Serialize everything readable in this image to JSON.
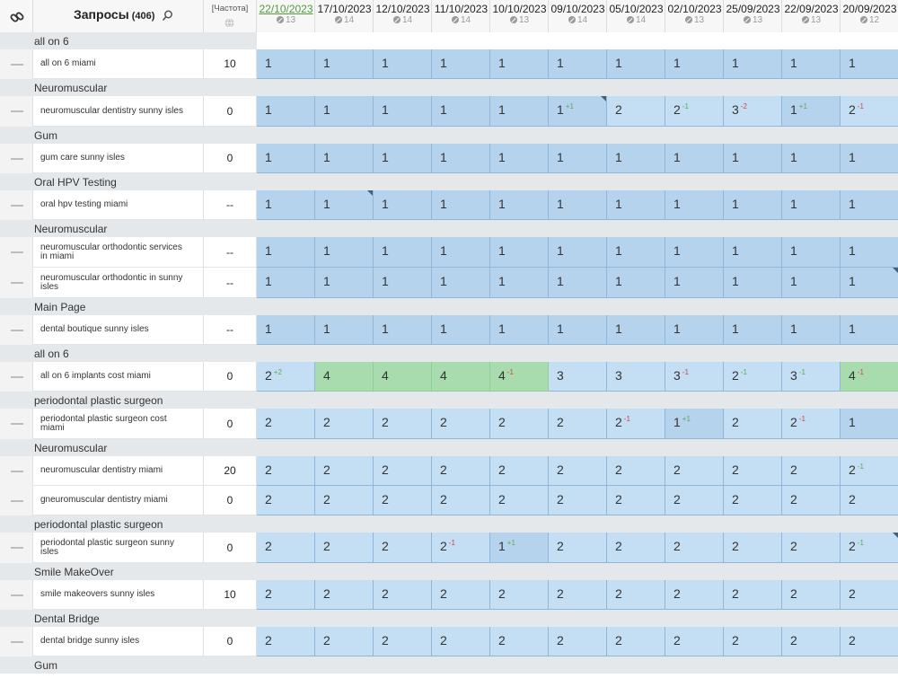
{
  "header": {
    "title": "Запросы",
    "count": "(406)",
    "frequency_label": "[Частота]",
    "dates": [
      {
        "date": "22/10/2023",
        "sub": "13",
        "active": true
      },
      {
        "date": "17/10/2023",
        "sub": "14"
      },
      {
        "date": "12/10/2023",
        "sub": "14"
      },
      {
        "date": "11/10/2023",
        "sub": "14"
      },
      {
        "date": "10/10/2023",
        "sub": "13"
      },
      {
        "date": "09/10/2023",
        "sub": "14"
      },
      {
        "date": "05/10/2023",
        "sub": "14"
      },
      {
        "date": "02/10/2023",
        "sub": "13"
      },
      {
        "date": "25/09/2023",
        "sub": "13"
      },
      {
        "date": "22/09/2023",
        "sub": "13"
      },
      {
        "date": "20/09/2023",
        "sub": "12"
      }
    ]
  },
  "colors": {
    "position_cell": "#b5d3ed",
    "position_cell_light": "#c4dff4",
    "position_cell_top": "#a8dcae",
    "group_row": "#e5e8eb",
    "delta_up": "#5aab4f",
    "delta_down": "#d94040",
    "active_date": "#4f9d3b"
  },
  "groups": [
    {
      "label": "all on 6",
      "rows": [
        {
          "keyword": "all on 6 miami",
          "freq": "10",
          "cells": [
            {
              "v": "1"
            },
            {
              "v": "1"
            },
            {
              "v": "1"
            },
            {
              "v": "1"
            },
            {
              "v": "1"
            },
            {
              "v": "1"
            },
            {
              "v": "1"
            },
            {
              "v": "1"
            },
            {
              "v": "1"
            },
            {
              "v": "1"
            },
            {
              "v": "1"
            }
          ]
        }
      ]
    },
    {
      "label": "Neuromuscular",
      "rows": [
        {
          "keyword": "neuromuscular dentistry sunny isles",
          "freq": "0",
          "cells": [
            {
              "v": "1"
            },
            {
              "v": "1"
            },
            {
              "v": "1"
            },
            {
              "v": "1"
            },
            {
              "v": "1"
            },
            {
              "v": "1",
              "d": "+1",
              "dir": "up",
              "flag": true
            },
            {
              "v": "2",
              "c": "l"
            },
            {
              "v": "2",
              "d": "-1",
              "dir": "up",
              "c": "l"
            },
            {
              "v": "3",
              "d": "-2",
              "dir": "down",
              "c": "l"
            },
            {
              "v": "1",
              "d": "+1",
              "dir": "up"
            },
            {
              "v": "2",
              "d": "-1",
              "dir": "down",
              "c": "l"
            }
          ]
        }
      ]
    },
    {
      "label": "Gum",
      "rows": [
        {
          "keyword": "gum care sunny isles",
          "freq": "0",
          "cells": [
            {
              "v": "1"
            },
            {
              "v": "1"
            },
            {
              "v": "1"
            },
            {
              "v": "1"
            },
            {
              "v": "1"
            },
            {
              "v": "1"
            },
            {
              "v": "1"
            },
            {
              "v": "1"
            },
            {
              "v": "1"
            },
            {
              "v": "1"
            },
            {
              "v": "1"
            }
          ]
        }
      ]
    },
    {
      "label": "Oral HPV Testing",
      "rows": [
        {
          "keyword": "oral hpv testing miami",
          "freq": "--",
          "cells": [
            {
              "v": "1"
            },
            {
              "v": "1",
              "flag": true
            },
            {
              "v": "1"
            },
            {
              "v": "1"
            },
            {
              "v": "1"
            },
            {
              "v": "1"
            },
            {
              "v": "1"
            },
            {
              "v": "1"
            },
            {
              "v": "1"
            },
            {
              "v": "1"
            },
            {
              "v": "1"
            }
          ]
        }
      ]
    },
    {
      "label": "Neuromuscular",
      "rows": [
        {
          "keyword": "neuromuscular orthodontic services in miami",
          "freq": "--",
          "cells": [
            {
              "v": "1"
            },
            {
              "v": "1"
            },
            {
              "v": "1"
            },
            {
              "v": "1"
            },
            {
              "v": "1"
            },
            {
              "v": "1"
            },
            {
              "v": "1"
            },
            {
              "v": "1"
            },
            {
              "v": "1"
            },
            {
              "v": "1"
            },
            {
              "v": "1"
            }
          ]
        },
        {
          "keyword": "neuromuscular orthodontic in sunny isles",
          "freq": "--",
          "cells": [
            {
              "v": "1"
            },
            {
              "v": "1"
            },
            {
              "v": "1"
            },
            {
              "v": "1"
            },
            {
              "v": "1"
            },
            {
              "v": "1"
            },
            {
              "v": "1"
            },
            {
              "v": "1"
            },
            {
              "v": "1"
            },
            {
              "v": "1"
            },
            {
              "v": "1",
              "flag": true
            }
          ]
        }
      ]
    },
    {
      "label": "Main Page",
      "rows": [
        {
          "keyword": "dental boutique sunny isles",
          "freq": "--",
          "cells": [
            {
              "v": "1"
            },
            {
              "v": "1"
            },
            {
              "v": "1"
            },
            {
              "v": "1"
            },
            {
              "v": "1"
            },
            {
              "v": "1"
            },
            {
              "v": "1"
            },
            {
              "v": "1"
            },
            {
              "v": "1"
            },
            {
              "v": "1"
            },
            {
              "v": "1"
            }
          ]
        }
      ]
    },
    {
      "label": "all on 6",
      "rows": [
        {
          "keyword": "all on 6 implants cost miami",
          "freq": "0",
          "cells": [
            {
              "v": "2",
              "d": "+2",
              "dir": "up",
              "c": "l"
            },
            {
              "v": "4",
              "c": "g"
            },
            {
              "v": "4",
              "c": "g"
            },
            {
              "v": "4",
              "c": "g"
            },
            {
              "v": "4",
              "d": "-1",
              "dir": "down",
              "c": "g"
            },
            {
              "v": "3",
              "c": "l"
            },
            {
              "v": "3",
              "c": "l"
            },
            {
              "v": "3",
              "d": "-1",
              "dir": "down",
              "c": "l"
            },
            {
              "v": "2",
              "d": "-1",
              "dir": "up",
              "c": "l"
            },
            {
              "v": "3",
              "d": "-1",
              "dir": "up",
              "c": "l"
            },
            {
              "v": "4",
              "d": "-1",
              "dir": "down",
              "c": "g"
            }
          ]
        }
      ]
    },
    {
      "label": "periodontal plastic surgeon",
      "rows": [
        {
          "keyword": "periodontal plastic surgeon cost miami",
          "freq": "0",
          "cells": [
            {
              "v": "2",
              "c": "l"
            },
            {
              "v": "2",
              "c": "l"
            },
            {
              "v": "2",
              "c": "l"
            },
            {
              "v": "2",
              "c": "l"
            },
            {
              "v": "2",
              "c": "l"
            },
            {
              "v": "2",
              "c": "l"
            },
            {
              "v": "2",
              "d": "-1",
              "dir": "down",
              "c": "l"
            },
            {
              "v": "1",
              "d": "+1",
              "dir": "up"
            },
            {
              "v": "2",
              "c": "l"
            },
            {
              "v": "2",
              "d": "-1",
              "dir": "down",
              "c": "l"
            },
            {
              "v": "1"
            }
          ]
        }
      ]
    },
    {
      "label": "Neuromuscular",
      "rows": [
        {
          "keyword": "neuromuscular dentistry miami",
          "freq": "20",
          "cells": [
            {
              "v": "2",
              "c": "l"
            },
            {
              "v": "2",
              "c": "l"
            },
            {
              "v": "2",
              "c": "l"
            },
            {
              "v": "2",
              "c": "l"
            },
            {
              "v": "2",
              "c": "l"
            },
            {
              "v": "2",
              "c": "l"
            },
            {
              "v": "2",
              "c": "l"
            },
            {
              "v": "2",
              "c": "l"
            },
            {
              "v": "2",
              "c": "l"
            },
            {
              "v": "2",
              "c": "l"
            },
            {
              "v": "2",
              "d": "-1",
              "dir": "up",
              "c": "l"
            }
          ]
        },
        {
          "keyword": "gneuromuscular dentistry miami",
          "freq": "0",
          "cells": [
            {
              "v": "2",
              "c": "l"
            },
            {
              "v": "2",
              "c": "l"
            },
            {
              "v": "2",
              "c": "l"
            },
            {
              "v": "2",
              "c": "l"
            },
            {
              "v": "2",
              "c": "l"
            },
            {
              "v": "2",
              "c": "l"
            },
            {
              "v": "2",
              "c": "l"
            },
            {
              "v": "2",
              "c": "l"
            },
            {
              "v": "2",
              "c": "l"
            },
            {
              "v": "2",
              "c": "l"
            },
            {
              "v": "2",
              "c": "l"
            }
          ]
        }
      ]
    },
    {
      "label": "periodontal plastic surgeon",
      "rows": [
        {
          "keyword": "periodontal plastic surgeon sunny isles",
          "freq": "0",
          "cells": [
            {
              "v": "2",
              "c": "l"
            },
            {
              "v": "2",
              "c": "l"
            },
            {
              "v": "2",
              "c": "l"
            },
            {
              "v": "2",
              "d": "-1",
              "dir": "down",
              "c": "l"
            },
            {
              "v": "1",
              "d": "+1",
              "dir": "up"
            },
            {
              "v": "2",
              "c": "l"
            },
            {
              "v": "2",
              "c": "l"
            },
            {
              "v": "2",
              "c": "l"
            },
            {
              "v": "2",
              "c": "l"
            },
            {
              "v": "2",
              "c": "l"
            },
            {
              "v": "2",
              "d": "-1",
              "dir": "up",
              "c": "l",
              "flag": true
            }
          ]
        }
      ]
    },
    {
      "label": "Smile MakeOver",
      "rows": [
        {
          "keyword": "smile makeovers sunny isles",
          "freq": "10",
          "cells": [
            {
              "v": "2",
              "c": "l"
            },
            {
              "v": "2",
              "c": "l"
            },
            {
              "v": "2",
              "c": "l"
            },
            {
              "v": "2",
              "c": "l"
            },
            {
              "v": "2",
              "c": "l"
            },
            {
              "v": "2",
              "c": "l"
            },
            {
              "v": "2",
              "c": "l"
            },
            {
              "v": "2",
              "c": "l"
            },
            {
              "v": "2",
              "c": "l"
            },
            {
              "v": "2",
              "c": "l"
            },
            {
              "v": "2",
              "c": "l"
            }
          ]
        }
      ]
    },
    {
      "label": "Dental Bridge",
      "rows": [
        {
          "keyword": "dental bridge sunny isles",
          "freq": "0",
          "cells": [
            {
              "v": "2",
              "c": "l"
            },
            {
              "v": "2",
              "c": "l"
            },
            {
              "v": "2",
              "c": "l"
            },
            {
              "v": "2",
              "c": "l"
            },
            {
              "v": "2",
              "c": "l"
            },
            {
              "v": "2",
              "c": "l"
            },
            {
              "v": "2",
              "c": "l"
            },
            {
              "v": "2",
              "c": "l"
            },
            {
              "v": "2",
              "c": "l"
            },
            {
              "v": "2",
              "c": "l"
            },
            {
              "v": "2",
              "c": "l"
            }
          ]
        }
      ]
    },
    {
      "label": "Gum",
      "rows": []
    }
  ]
}
